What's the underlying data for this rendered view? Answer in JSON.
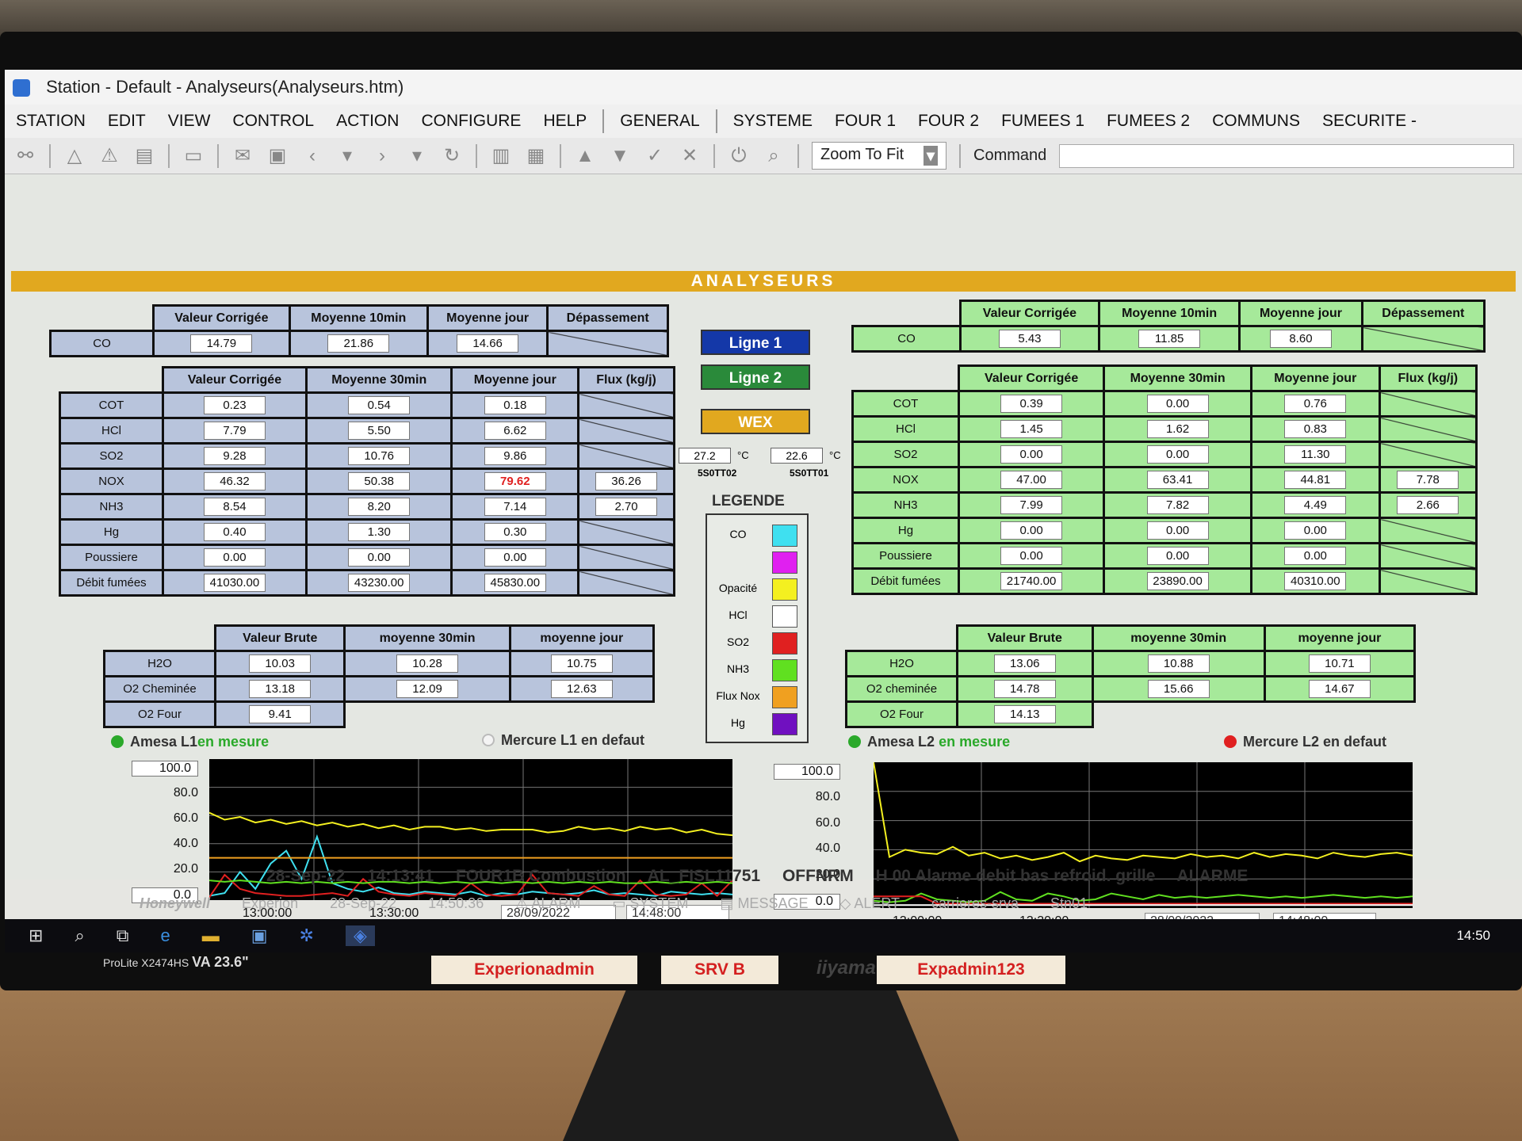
{
  "window": {
    "title": "Station - Default - Analyseurs(Analyseurs.htm)"
  },
  "menu": [
    "STATION",
    "EDIT",
    "VIEW",
    "CONTROL",
    "ACTION",
    "CONFIGURE",
    "HELP",
    "GENERAL",
    "SYSTEME",
    "FOUR 1",
    "FOUR 2",
    "FUMEES 1",
    "FUMEES 2",
    "COMMUNS",
    "SECURITE -"
  ],
  "toolbar": {
    "zoom": "Zoom To Fit",
    "command_label": "Command"
  },
  "banner": "ANALYSEURS",
  "l1": {
    "co_headers": [
      "Valeur Corrigée",
      "Moyenne 10min",
      "Moyenne jour",
      "Dépassement"
    ],
    "co": {
      "label": "CO",
      "v": "14.79",
      "m10": "21.86",
      "mj": "14.66"
    },
    "main_headers": [
      "Valeur Corrigée",
      "Moyenne 30min",
      "Moyenne jour",
      "Flux (kg/j)"
    ],
    "rows": [
      {
        "label": "COT",
        "v": "0.23",
        "m30": "0.54",
        "mj": "0.18",
        "flux": ""
      },
      {
        "label": "HCl",
        "v": "7.79",
        "m30": "5.50",
        "mj": "6.62",
        "flux": ""
      },
      {
        "label": "SO2",
        "v": "9.28",
        "m30": "10.76",
        "mj": "9.86",
        "flux": ""
      },
      {
        "label": "NOX",
        "v": "46.32",
        "m30": "50.38",
        "mj": "79.62",
        "flux": "36.26"
      },
      {
        "label": "NH3",
        "v": "8.54",
        "m30": "8.20",
        "mj": "7.14",
        "flux": "2.70"
      },
      {
        "label": "Hg",
        "v": "0.40",
        "m30": "1.30",
        "mj": "0.30",
        "flux": ""
      },
      {
        "label": "Poussiere",
        "v": "0.00",
        "m30": "0.00",
        "mj": "0.00",
        "flux": ""
      },
      {
        "label": "Débit fumées",
        "v": "41030.00",
        "m30": "43230.00",
        "mj": "45830.00",
        "flux": ""
      }
    ],
    "h2o_headers": [
      "Valeur Brute",
      "moyenne 30min",
      "moyenne jour"
    ],
    "h2o_rows": [
      {
        "label": "H2O",
        "v": "10.03",
        "m30": "10.28",
        "mj": "10.75"
      },
      {
        "label": "O2 Cheminée",
        "v": "13.18",
        "m30": "12.09",
        "mj": "12.63"
      },
      {
        "label": "O2 Four",
        "v": "9.41"
      }
    ],
    "status_left": "Amesa L1",
    "status_left_state": "en mesure",
    "status_right": "Mercure L1 en defaut"
  },
  "l2": {
    "co_headers": [
      "Valeur Corrigée",
      "Moyenne 10min",
      "Moyenne jour",
      "Dépassement"
    ],
    "co": {
      "label": "CO",
      "v": "5.43",
      "m10": "11.85",
      "mj": "8.60"
    },
    "main_headers": [
      "Valeur Corrigée",
      "Moyenne 30min",
      "Moyenne jour",
      "Flux (kg/j)"
    ],
    "rows": [
      {
        "label": "COT",
        "v": "0.39",
        "m30": "0.00",
        "mj": "0.76",
        "flux": ""
      },
      {
        "label": "HCl",
        "v": "1.45",
        "m30": "1.62",
        "mj": "0.83",
        "flux": ""
      },
      {
        "label": "SO2",
        "v": "0.00",
        "m30": "0.00",
        "mj": "11.30",
        "flux": ""
      },
      {
        "label": "NOX",
        "v": "47.00",
        "m30": "63.41",
        "mj": "44.81",
        "flux": "7.78"
      },
      {
        "label": "NH3",
        "v": "7.99",
        "m30": "7.82",
        "mj": "4.49",
        "flux": "2.66"
      },
      {
        "label": "Hg",
        "v": "0.00",
        "m30": "0.00",
        "mj": "0.00",
        "flux": ""
      },
      {
        "label": "Poussiere",
        "v": "0.00",
        "m30": "0.00",
        "mj": "0.00",
        "flux": ""
      },
      {
        "label": "Débit fumées",
        "v": "21740.00",
        "m30": "23890.00",
        "mj": "40310.00",
        "flux": ""
      }
    ],
    "h2o_headers": [
      "Valeur Brute",
      "moyenne 30min",
      "moyenne jour"
    ],
    "h2o_rows": [
      {
        "label": "H2O",
        "v": "13.06",
        "m30": "10.88",
        "mj": "10.71"
      },
      {
        "label": "O2 cheminée",
        "v": "14.78",
        "m30": "15.66",
        "mj": "14.67"
      },
      {
        "label": "O2 Four",
        "v": "14.13"
      }
    ],
    "status_left": "Amesa L2",
    "status_left_state": "en mesure",
    "status_right": "Mercure L2 en defaut"
  },
  "center": {
    "btn1": "Ligne 1",
    "btn2": "Ligne 2",
    "btn3": "WEX",
    "t1": "27.2",
    "t2": "22.6",
    "unit": "°C",
    "t1_tag": "5S0TT02",
    "t2_tag": "5S0TT01",
    "legend_title": "LEGENDE",
    "legend": [
      {
        "label": "CO",
        "color": "#3fe0f0"
      },
      {
        "label": "",
        "color": "#e020f0"
      },
      {
        "label": "Opacité",
        "color": "#f4f020"
      },
      {
        "label": "HCl",
        "color": "#ffffff"
      },
      {
        "label": "SO2",
        "color": "#e02020"
      },
      {
        "label": "NH3",
        "color": "#60e020"
      },
      {
        "label": "Flux Nox",
        "color": "#f0a020"
      },
      {
        "label": "Hg",
        "color": "#7010c0"
      }
    ]
  },
  "chart_data": [
    {
      "type": "line",
      "yticks": [
        "100.0",
        "80.0",
        "60.0",
        "40.0",
        "20.0",
        "0.0"
      ],
      "xticks": [
        "13:00:00",
        "13:30:00"
      ],
      "date": "28/09/2022",
      "time": "14:48:00",
      "ylim": [
        0,
        100
      ],
      "series": [
        {
          "color": "#f4f020",
          "values": [
            62,
            57,
            59,
            55,
            57,
            54,
            56,
            53,
            55,
            52,
            54,
            51,
            53,
            50,
            52,
            52,
            50,
            51,
            49,
            50,
            50,
            50,
            48,
            49,
            52,
            50,
            51,
            49,
            52,
            50,
            51,
            48,
            50,
            47,
            46
          ]
        },
        {
          "color": "#3fe0f0",
          "values": [
            3,
            5,
            20,
            8,
            26,
            35,
            15,
            45,
            12,
            8,
            6,
            9,
            5,
            4,
            6,
            5,
            4,
            6,
            3,
            5,
            4,
            6,
            5,
            4,
            5,
            7,
            4,
            5,
            4,
            3,
            6,
            5,
            4,
            5,
            4
          ]
        },
        {
          "color": "#e02020",
          "values": [
            2,
            18,
            8,
            5,
            4,
            3,
            3,
            4,
            5,
            3,
            15,
            6,
            4,
            3,
            5,
            4,
            3,
            12,
            4,
            3,
            4,
            18,
            5,
            4,
            3,
            10,
            4,
            3,
            14,
            4,
            3,
            4,
            12,
            3,
            14
          ]
        },
        {
          "color": "#60e020",
          "values": [
            14,
            13,
            14,
            13,
            12,
            13,
            12,
            13,
            12,
            13,
            12,
            13,
            13,
            12,
            13,
            12,
            13,
            12,
            13,
            12,
            13,
            12,
            13,
            12,
            13,
            12,
            13,
            12,
            12,
            13,
            12,
            13,
            12,
            13,
            12
          ]
        },
        {
          "color": "#f0a020",
          "values": [
            30,
            30,
            30,
            30,
            30,
            30,
            30,
            30,
            30,
            30,
            30,
            30,
            30,
            30,
            30,
            30,
            30,
            30,
            30,
            30,
            30,
            30,
            30,
            30,
            30,
            30,
            30,
            30,
            30,
            30,
            30,
            30,
            30,
            30,
            30
          ]
        }
      ]
    },
    {
      "type": "line",
      "yticks": [
        "100.0",
        "80.0",
        "60.0",
        "40.0",
        "20.0",
        "0.0"
      ],
      "xticks": [
        "13:00:00",
        "13:30:00"
      ],
      "date": "28/09/2022",
      "time": "14:48:00",
      "ylim": [
        0,
        100
      ],
      "series": [
        {
          "color": "#f4f020",
          "values": [
            100,
            35,
            40,
            38,
            37,
            42,
            36,
            38,
            34,
            36,
            33,
            35,
            38,
            32,
            36,
            34,
            33,
            36,
            35,
            34,
            37,
            35,
            36,
            34,
            38,
            35,
            37,
            36,
            34,
            38,
            36,
            35,
            37,
            38,
            36
          ]
        },
        {
          "color": "#60e020",
          "values": [
            5,
            4,
            5,
            10,
            6,
            5,
            4,
            5,
            11,
            6,
            5,
            10,
            8,
            5,
            6,
            10,
            8,
            6,
            9,
            7,
            8,
            7,
            8,
            9,
            8,
            7,
            8,
            7,
            8,
            9,
            8,
            7,
            8,
            7,
            8
          ]
        },
        {
          "color": "#e02020",
          "values": [
            8,
            8,
            8,
            8,
            3,
            3,
            3,
            3,
            3,
            3,
            3,
            3,
            3,
            3,
            3,
            3,
            3,
            3,
            3,
            3,
            3,
            3,
            3,
            3,
            3,
            3,
            3,
            3,
            3,
            3,
            3,
            3,
            3,
            3,
            3
          ]
        },
        {
          "color": "#ffffff",
          "values": [
            2,
            2,
            2,
            2,
            2,
            2,
            2,
            2,
            2,
            2,
            2,
            2,
            2,
            2,
            2,
            2,
            2,
            2,
            2,
            2,
            2,
            2,
            2,
            2,
            2,
            2,
            2,
            2,
            2,
            2,
            2,
            2,
            2,
            2,
            2
          ]
        }
      ]
    }
  ],
  "alarm": {
    "date": "28-Sep-22",
    "time": "14:13:41",
    "unit": "FOUR1B Combustion",
    "tag": "AL_FISL11751",
    "state": "OFFNRM",
    "desc": "H 00 Alarme debit bas refroid. grille",
    "type": "ALARME"
  },
  "statusbar": {
    "brand": "Honeywell",
    "app": "Experion",
    "date": "28-Sep-22",
    "time": "14:50:36",
    "alarm": "ALARM",
    "system": "SYSTEM",
    "message": "MESSAGE",
    "alert": "ALERT",
    "host": "carrieres-srva",
    "station": "Stn01"
  },
  "taskbar": {
    "clock": "14:50"
  },
  "stickers": [
    "Experionadmin",
    "SRV B",
    "Expadmin123"
  ],
  "monitor": {
    "brand": "iiyama",
    "model": "ProLite X2474HS",
    "size": "VA 23.6\""
  }
}
